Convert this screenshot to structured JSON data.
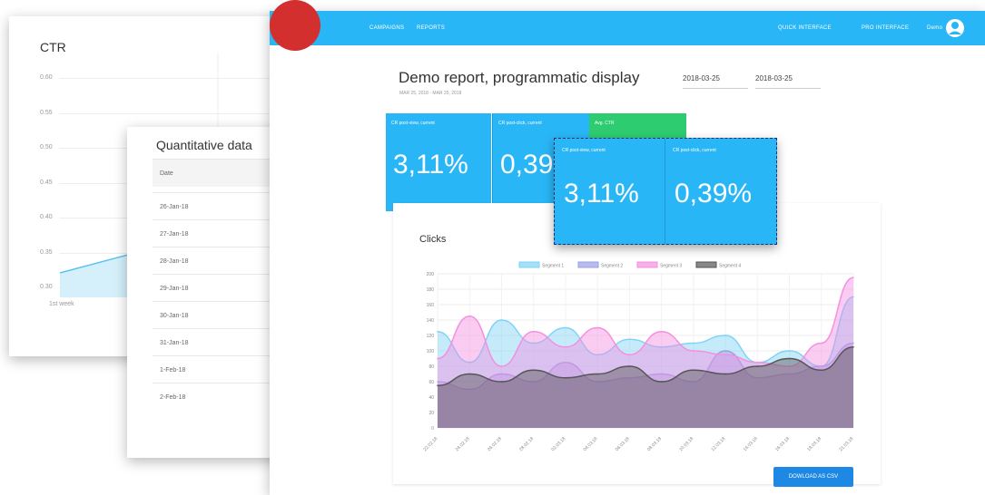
{
  "ctr_card": {
    "title": "CTR",
    "y_ticks": [
      "0.60",
      "0.55",
      "0.50",
      "0.45",
      "0.40",
      "0.35",
      "0.30"
    ],
    "x_first_label": "1st week"
  },
  "quantitative": {
    "title": "Quantitative data",
    "header": "Date",
    "rows": [
      "26-Jan-18",
      "27-Jan-18",
      "28-Jan-18",
      "29-Jan-18",
      "30-Jan-18",
      "31-Jan-18",
      "1-Feb-18",
      "2-Feb-18"
    ]
  },
  "topbar": {
    "color": "#29b6f6",
    "nav_campaigns": "CAMPAIGNS",
    "nav_reports": "REPORTS",
    "quick": "QUICK INTERFACE",
    "pro": "PRO INTERFACE",
    "user": "Demo"
  },
  "report": {
    "title": "Demo report, programmatic display",
    "subtitle": "MAR 25, 2018 - MAR 25, 2018",
    "date_from": "2018-03-25",
    "date_to": "2018-03-25"
  },
  "kpis": {
    "cr_view_label": "CR post-view, current",
    "cr_view_value": "3,11%",
    "cr_click_label": "CR post-click, current",
    "cr_click_value": "0,39",
    "avg_ctr_label": "Avg. CTR"
  },
  "overlay": {
    "cr_view_label": "CR post-view, current",
    "cr_view_value": "3,11%",
    "cr_click_label": "CR post-click, current",
    "cr_click_value": "0,39%"
  },
  "download_label": "DOWLOAD AS CSV",
  "chart_data": {
    "type": "area",
    "title": "Clicks",
    "ylim": [
      0,
      200
    ],
    "y_ticks": [
      "200",
      "180",
      "160",
      "140",
      "120",
      "100",
      "80",
      "60",
      "40",
      "20",
      "0"
    ],
    "x": [
      "22.02.18",
      "24.02.18",
      "26.02.18",
      "28.02.18",
      "02.03.18",
      "04.03.18",
      "06.03.18",
      "08.03.18",
      "10.03.18",
      "12.03.18",
      "14.03.18",
      "16.03.18",
      "18.03.18",
      "21.03.18"
    ],
    "series": [
      {
        "name": "Segment 1",
        "color": "#7fd3f7",
        "values": [
          125,
          85,
          140,
          110,
          130,
          95,
          115,
          105,
          110,
          120,
          85,
          100,
          80,
          170
        ]
      },
      {
        "name": "Segment 2",
        "color": "#9aa0e6",
        "values": [
          60,
          50,
          70,
          60,
          85,
          60,
          65,
          70,
          60,
          100,
          65,
          70,
          80,
          110
        ]
      },
      {
        "name": "Segment 3",
        "color": "#f58fe0",
        "values": [
          90,
          145,
          80,
          125,
          105,
          130,
          95,
          125,
          100,
          95,
          85,
          80,
          110,
          195
        ]
      },
      {
        "name": "Segment 4",
        "color": "#555555",
        "values": [
          55,
          70,
          60,
          75,
          65,
          70,
          80,
          60,
          75,
          70,
          80,
          90,
          75,
          105
        ]
      }
    ],
    "grid": true,
    "legend": "top"
  }
}
